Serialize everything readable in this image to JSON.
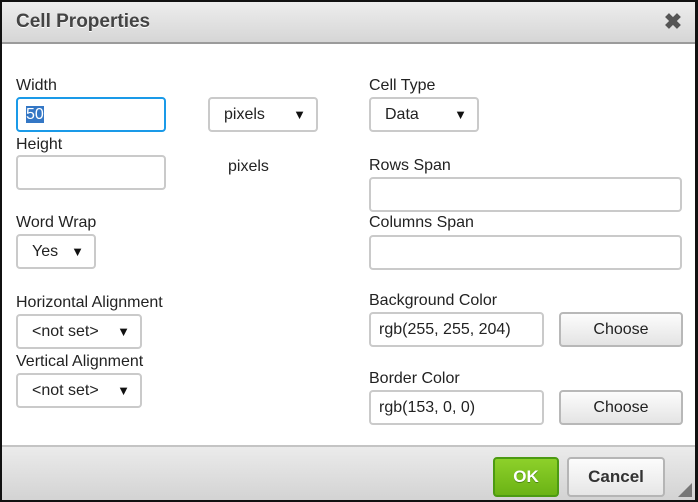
{
  "dialog": {
    "title": "Cell Properties",
    "close_icon": "close-icon"
  },
  "left": {
    "width_label": "Width",
    "width_value": "50",
    "width_unit_select": "pixels",
    "height_label": "Height",
    "height_value": "",
    "height_unit_text": "pixels",
    "word_wrap_label": "Word Wrap",
    "word_wrap_value": "Yes",
    "h_align_label": "Horizontal Alignment",
    "h_align_value": "<not set>",
    "v_align_label": "Vertical Alignment",
    "v_align_value": "<not set>"
  },
  "right": {
    "cell_type_label": "Cell Type",
    "cell_type_value": "Data",
    "rows_span_label": "Rows Span",
    "rows_span_value": "",
    "cols_span_label": "Columns Span",
    "cols_span_value": "",
    "bg_color_label": "Background Color",
    "bg_color_value": "rgb(255, 255, 204)",
    "border_color_label": "Border Color",
    "border_color_value": "rgb(153, 0, 0)",
    "choose_label": "Choose"
  },
  "footer": {
    "ok_label": "OK",
    "cancel_label": "Cancel"
  },
  "arrow_glyph": "▼",
  "close_glyph": "✖"
}
